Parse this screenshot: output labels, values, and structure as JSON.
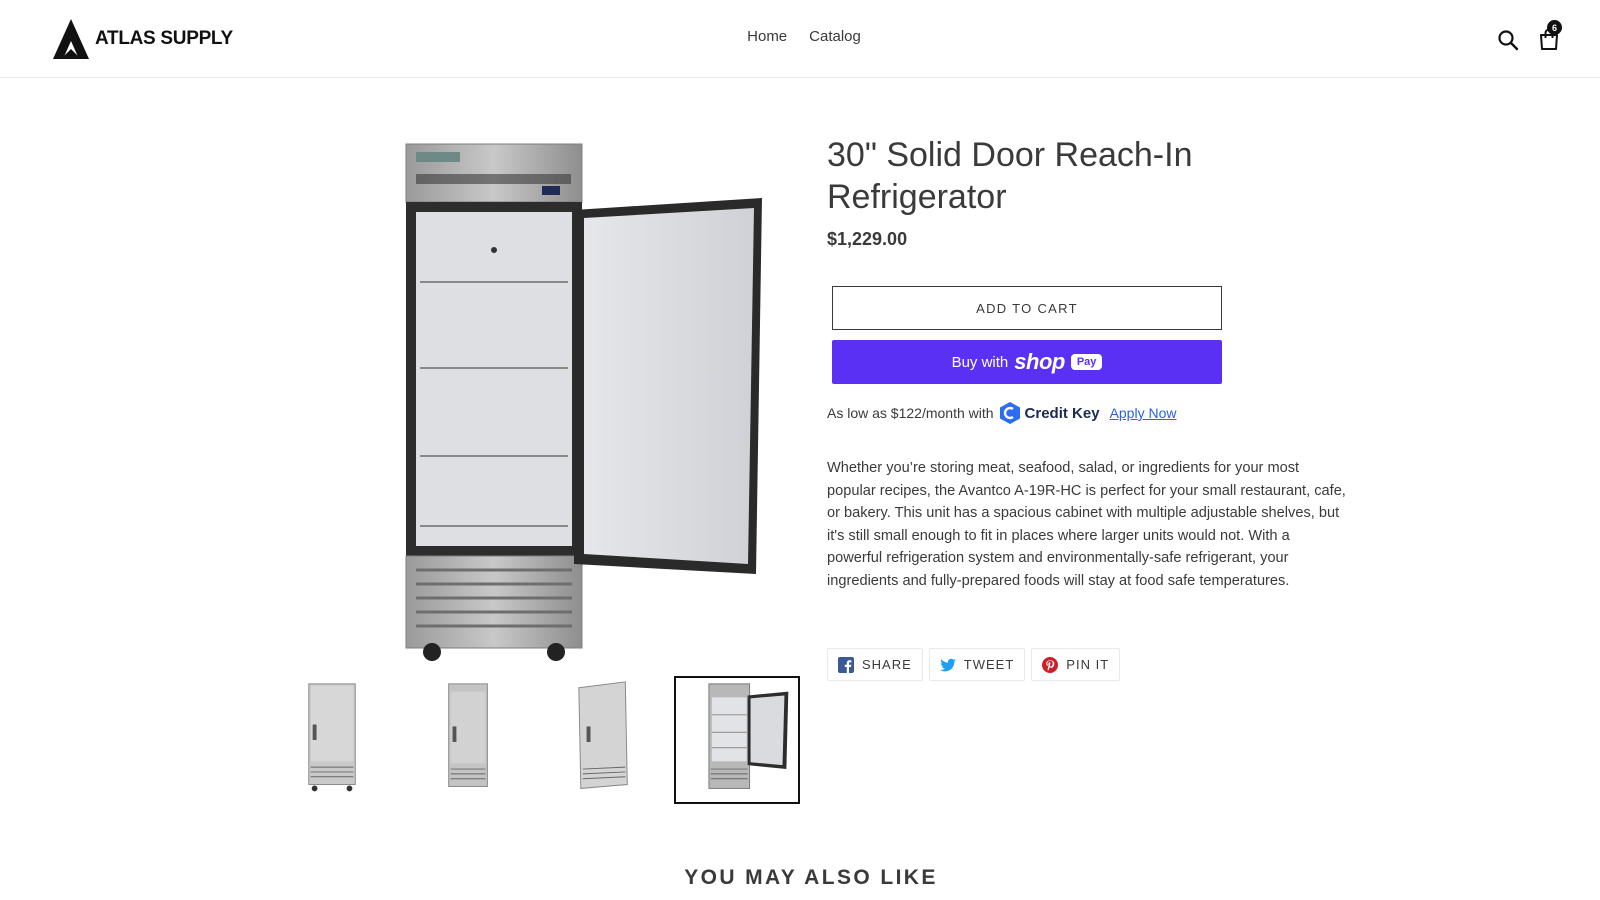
{
  "header": {
    "brand": "ATLAS SUPPLY",
    "nav": [
      {
        "label": "Home"
      },
      {
        "label": "Catalog"
      }
    ],
    "cart_count": "6",
    "icons": {
      "search": "search-icon",
      "cart": "cart-icon"
    }
  },
  "product": {
    "title": "30\" Solid Door Reach-In Refrigerator",
    "price": "$1,229.00",
    "add_to_cart": "ADD TO CART",
    "shoppay": {
      "buy_with": "Buy with",
      "shop": "shop",
      "pay": "Pay"
    },
    "financing": {
      "text": "As low as $122/month with",
      "provider": "Credit Key",
      "link": "Apply Now"
    },
    "description": "Whether you’re storing meat, seafood, salad, or ingredients for your most popular recipes, the Avantco A-19R-HC is perfect for your small restaurant, cafe, or bakery. This unit has a spacious cabinet with multiple adjustable shelves, but it's still small enough to fit in places where larger units would not. With a powerful refrigeration system and environmentally-safe refrigerant, your ingredients and fully-prepared foods will stay at food safe temperatures.",
    "thumbnails": [
      {
        "view": "front-closed"
      },
      {
        "view": "front-closed-straight"
      },
      {
        "view": "angle-closed"
      },
      {
        "view": "front-open",
        "active": true
      }
    ],
    "share": [
      {
        "label": "SHARE",
        "icon": "facebook-icon"
      },
      {
        "label": "TWEET",
        "icon": "twitter-icon"
      },
      {
        "label": "PIN IT",
        "icon": "pinterest-icon"
      }
    ]
  },
  "related": {
    "heading": "YOU MAY ALSO LIKE"
  },
  "colors": {
    "text": "#3a3a3a",
    "shoppay": "#5a31f4",
    "link": "#2563eb",
    "facebook": "#3b5998",
    "twitter": "#1da1f2",
    "pinterest": "#cb2027"
  }
}
